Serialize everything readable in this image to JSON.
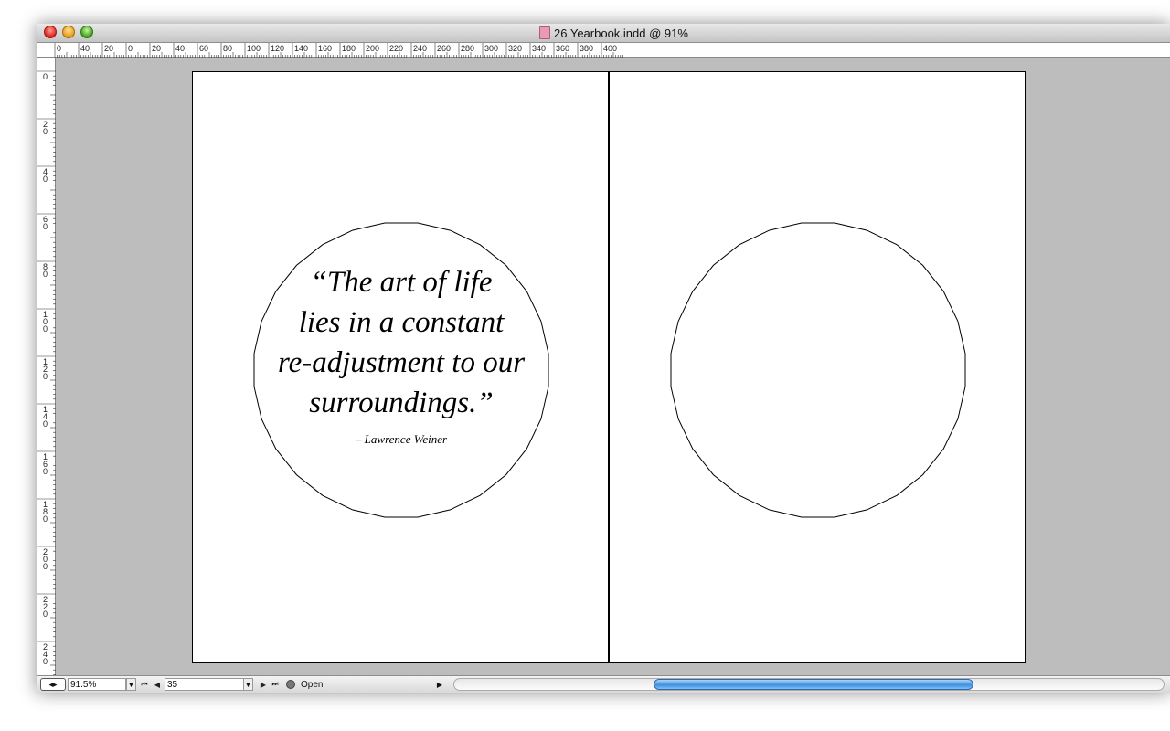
{
  "window": {
    "title": "26 Yearbook.indd @ 91%"
  },
  "rulers": {
    "horizontal_labels": [
      "0",
      "40",
      "20",
      "0",
      "20",
      "40",
      "60",
      "80",
      "100",
      "120",
      "140",
      "160",
      "180",
      "200",
      "220",
      "240",
      "260",
      "280",
      "300",
      "320",
      "340",
      "360",
      "380",
      "400"
    ],
    "vertical_labels": [
      "0",
      "20",
      "40",
      "60",
      "80",
      "100",
      "120",
      "140",
      "160",
      "180",
      "200",
      "220",
      "240"
    ]
  },
  "spread": {
    "quote_lines": [
      "“The art of life",
      "lies in a constant",
      "re-adjustment to our",
      "surroundings.”"
    ],
    "attribution": "– Lawrence Weiner"
  },
  "statusbar": {
    "zoom_value": "91.5%",
    "page_value": "35",
    "status_text": "Open"
  },
  "icons": {
    "close": "close-button-icon",
    "minimize": "minimize-button-icon",
    "zoom": "zoom-button-icon",
    "document": "indesign-document-icon",
    "first": "first-page-icon",
    "prev": "previous-page-icon",
    "next": "next-page-icon",
    "last": "last-page-icon",
    "dropdown": "dropdown-arrow-icon"
  },
  "colors": {
    "pasteboard": "#bdbdbd",
    "scroll_thumb": "#3e8fe0"
  }
}
